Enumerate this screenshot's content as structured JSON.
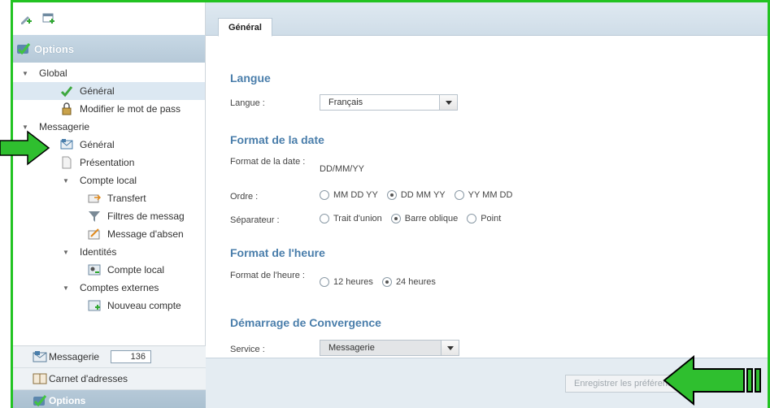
{
  "sidebar": {
    "header": "Options",
    "tree": [
      {
        "label": "Global",
        "level": 0,
        "expandable": true,
        "icon": "none"
      },
      {
        "label": "Général",
        "level": 2,
        "icon": "checkmark-icon",
        "selected": true
      },
      {
        "label": "Modifier le mot de pass",
        "level": 2,
        "icon": "lock-icon"
      },
      {
        "label": "Messagerie",
        "level": 0,
        "expandable": true,
        "icon": "none"
      },
      {
        "label": "Général",
        "level": 2,
        "icon": "mail-gear-icon"
      },
      {
        "label": "Présentation",
        "level": 2,
        "icon": "page-icon"
      },
      {
        "label": "Compte local",
        "level": 1,
        "expandable": true,
        "icon": "none"
      },
      {
        "label": "Transfert",
        "level": 3,
        "icon": "forward-mail-icon"
      },
      {
        "label": "Filtres de messag",
        "level": 3,
        "icon": "filter-icon"
      },
      {
        "label": "Message d'absen",
        "level": 3,
        "icon": "away-message-icon"
      },
      {
        "label": "Identités",
        "level": 1,
        "expandable": true,
        "icon": "none"
      },
      {
        "label": "Compte local",
        "level": 3,
        "icon": "identity-card-icon"
      },
      {
        "label": "Comptes externes",
        "level": 1,
        "expandable": true,
        "icon": "none"
      },
      {
        "label": "Nouveau compte",
        "level": 3,
        "icon": "new-account-icon"
      }
    ],
    "bottom": {
      "messagerie_label": "Messagerie",
      "messagerie_count": "136",
      "carnet_label": "Carnet d'adresses",
      "options_label": "Options"
    }
  },
  "main": {
    "tab": "Général",
    "langue": {
      "title": "Langue",
      "label": "Langue :",
      "value": "Français"
    },
    "date": {
      "title": "Format de la date",
      "format_label": "Format de la date :",
      "format_value": "DD/MM/YY",
      "order_label": "Ordre :",
      "order_options": [
        "MM DD YY",
        "DD MM YY",
        "YY MM DD"
      ],
      "order_selected": 1,
      "sep_label": "Séparateur :",
      "sep_options": [
        "Trait d'union",
        "Barre oblique",
        "Point"
      ],
      "sep_selected": 1
    },
    "heure": {
      "title": "Format de l'heure",
      "format_label": "Format de l'heure :",
      "options": [
        "12 heures",
        "24 heures"
      ],
      "selected": 1
    },
    "demarrage": {
      "title": "Démarrage de Convergence",
      "service_label": "Service :",
      "service_value": "Messagerie"
    },
    "save_button": "Enregistrer les préférences"
  },
  "colors": {
    "accent": "#4a7eab",
    "frame": "#22c322",
    "arrow": "#2fbf2f"
  }
}
